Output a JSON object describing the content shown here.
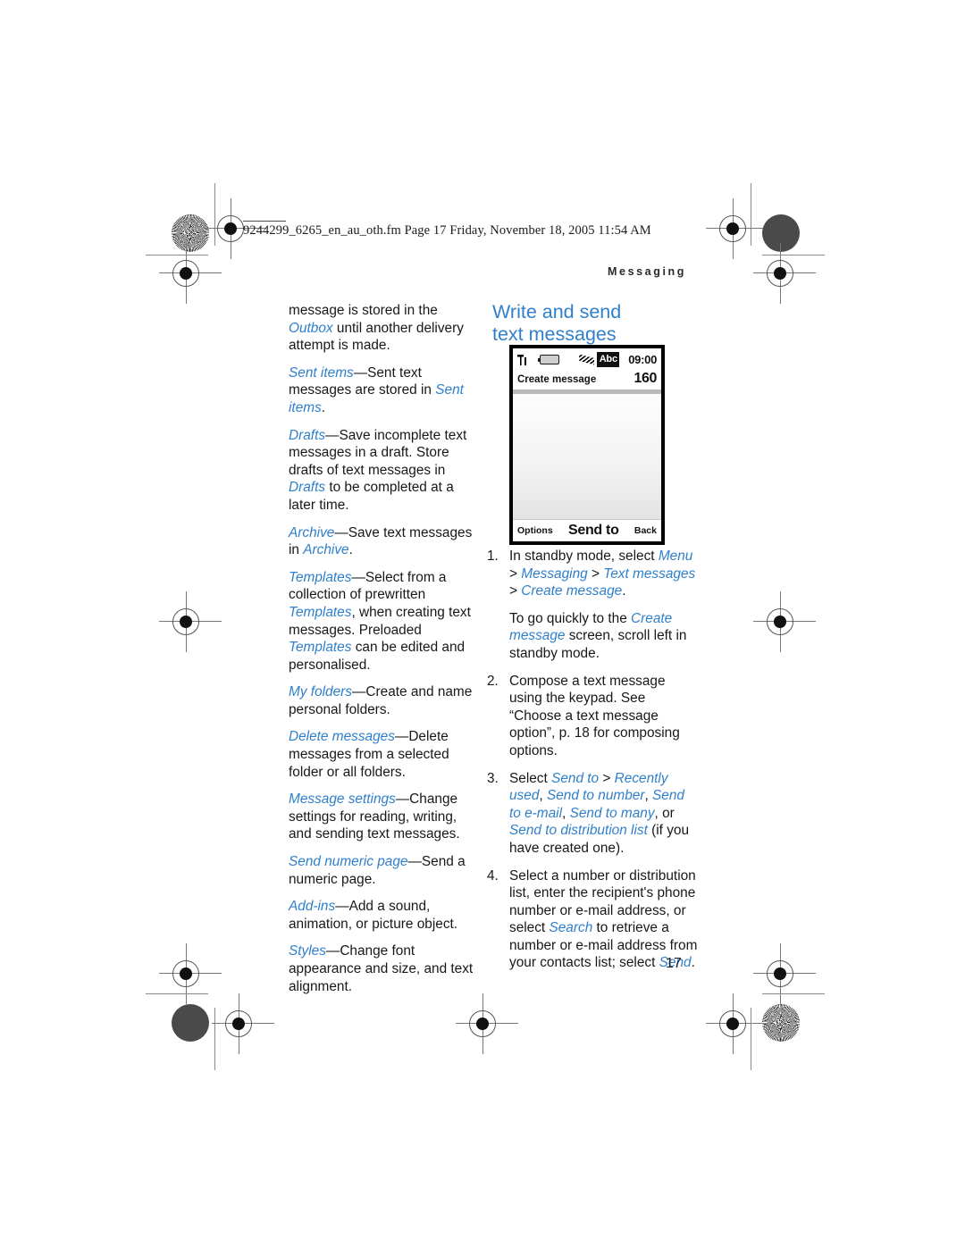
{
  "page": {
    "file_stamp": "9244299_6265_en_au_oth.fm  Page 17  Friday, November 18, 2005  11:54 AM",
    "section_header": "Messaging",
    "folio": "17"
  },
  "heading": {
    "line1": "Write and send",
    "line2": "text messages"
  },
  "left_column": {
    "paragraphs": [
      [
        {
          "t": "message is stored in the ",
          "s": "plain"
        },
        {
          "t": "Outbox",
          "s": "term"
        },
        {
          "t": " until another delivery attempt is made.",
          "s": "plain"
        }
      ],
      [
        {
          "t": "Sent items",
          "s": "term"
        },
        {
          "t": "—Sent text messages are stored in ",
          "s": "plain"
        },
        {
          "t": "Sent items",
          "s": "term"
        },
        {
          "t": ".",
          "s": "plain"
        }
      ],
      [
        {
          "t": "Drafts",
          "s": "term"
        },
        {
          "t": "—Save incomplete text messages in a draft. Store drafts of text messages in ",
          "s": "plain"
        },
        {
          "t": "Drafts",
          "s": "term"
        },
        {
          "t": " to be completed at a later time.",
          "s": "plain"
        }
      ],
      [
        {
          "t": "Archive",
          "s": "term"
        },
        {
          "t": "—Save text messages in ",
          "s": "plain"
        },
        {
          "t": "Archive",
          "s": "term"
        },
        {
          "t": ".",
          "s": "plain"
        }
      ],
      [
        {
          "t": "Templates",
          "s": "term"
        },
        {
          "t": "—Select from a collection of prewritten ",
          "s": "plain"
        },
        {
          "t": "Templates",
          "s": "term"
        },
        {
          "t": ", when creating text messages. Preloaded ",
          "s": "plain"
        },
        {
          "t": "Templates",
          "s": "term"
        },
        {
          "t": " can be edited and personalised.",
          "s": "plain"
        }
      ],
      [
        {
          "t": "My folders",
          "s": "term"
        },
        {
          "t": "—Create and name personal folders.",
          "s": "plain"
        }
      ],
      [
        {
          "t": "Delete messages",
          "s": "term"
        },
        {
          "t": "—Delete messages from a selected folder or all folders.",
          "s": "plain"
        }
      ],
      [
        {
          "t": "Message settings",
          "s": "term"
        },
        {
          "t": "—Change settings for reading, writing, and sending text messages.",
          "s": "plain"
        }
      ],
      [
        {
          "t": "Send numeric page",
          "s": "term"
        },
        {
          "t": "—Send a numeric page.",
          "s": "plain"
        }
      ],
      [
        {
          "t": "Add-ins",
          "s": "term"
        },
        {
          "t": "—Add a sound, animation, or picture object.",
          "s": "plain"
        }
      ],
      [
        {
          "t": "Styles",
          "s": "term"
        },
        {
          "t": "—Change font appearance and size, and text alignment.",
          "s": "plain"
        }
      ]
    ]
  },
  "phone": {
    "status": {
      "signal_icon": "signal-bars-icon",
      "battery_icon": "battery-icon",
      "message_icon": "message-stack-icon",
      "input_mode": "Abc",
      "time": "09:00"
    },
    "title": "Create message",
    "char_count": "160",
    "softkey_left": "Options",
    "softkey_center": "Send to",
    "softkey_right": "Back"
  },
  "steps": [
    {
      "num": "1.",
      "paragraphs": [
        [
          {
            "t": "In standby mode, select ",
            "s": "plain"
          },
          {
            "t": "Menu",
            "s": "term"
          },
          {
            "t": " > ",
            "s": "plain"
          },
          {
            "t": "Messaging",
            "s": "term"
          },
          {
            "t": " > ",
            "s": "plain"
          },
          {
            "t": "Text messages",
            "s": "term"
          },
          {
            "t": " > ",
            "s": "plain"
          },
          {
            "t": "Create message",
            "s": "term"
          },
          {
            "t": ".",
            "s": "plain"
          }
        ],
        [
          {
            "t": "To go quickly to the ",
            "s": "plain"
          },
          {
            "t": "Create message",
            "s": "term"
          },
          {
            "t": " screen, scroll left in standby mode.",
            "s": "plain"
          }
        ]
      ]
    },
    {
      "num": "2.",
      "paragraphs": [
        [
          {
            "t": "Compose a text message using the keypad. See “Choose a text message option”, p. 18 for composing options.",
            "s": "plain"
          }
        ]
      ]
    },
    {
      "num": "3.",
      "paragraphs": [
        [
          {
            "t": "Select ",
            "s": "plain"
          },
          {
            "t": "Send to",
            "s": "term"
          },
          {
            "t": " > ",
            "s": "plain"
          },
          {
            "t": "Recently used",
            "s": "term"
          },
          {
            "t": ", ",
            "s": "plain"
          },
          {
            "t": "Send to number",
            "s": "term"
          },
          {
            "t": ", ",
            "s": "plain"
          },
          {
            "t": "Send to e-mail",
            "s": "term"
          },
          {
            "t": ", ",
            "s": "plain"
          },
          {
            "t": "Send to many",
            "s": "term"
          },
          {
            "t": ", or ",
            "s": "plain"
          },
          {
            "t": "Send to distribution list",
            "s": "term"
          },
          {
            "t": " (if you have created one).",
            "s": "plain"
          }
        ]
      ]
    },
    {
      "num": "4.",
      "paragraphs": [
        [
          {
            "t": "Select a number or distribution list, enter the recipient's phone number or e-mail address, or select ",
            "s": "plain"
          },
          {
            "t": "Search",
            "s": "term"
          },
          {
            "t": " to retrieve a number or e-mail address from your contacts list; select ",
            "s": "plain"
          },
          {
            "t": "Send",
            "s": "term"
          },
          {
            "t": ".",
            "s": "plain"
          }
        ]
      ]
    }
  ],
  "colors": {
    "accent_blue": "#2f7fcb",
    "text_black": "#16181a"
  }
}
